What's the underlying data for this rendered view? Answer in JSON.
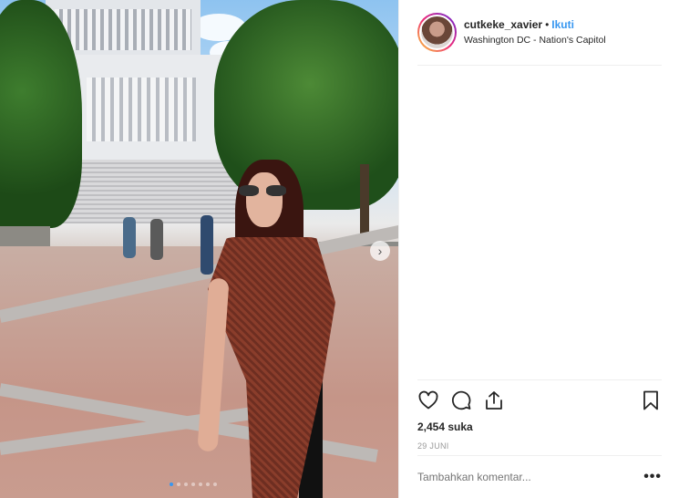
{
  "post": {
    "username": "cutkeke_xavier",
    "separator": "•",
    "follow_label": "Ikuti",
    "location": "Washington DC - Nation's Capitol",
    "likes": "2,454 suka",
    "date": "29 JUNI",
    "comment_placeholder": "Tambahkan komentar...",
    "more_label": "•••"
  },
  "carousel": {
    "next_icon": "chevron-right-icon",
    "next_glyph": "›",
    "total_dots": 7,
    "active_dot": 1
  },
  "icons": {
    "like": "heart-icon",
    "comment": "comment-icon",
    "share": "share-icon",
    "save": "bookmark-icon"
  },
  "colors": {
    "link": "#3897f0",
    "text": "#262626",
    "muted": "#999999",
    "divider": "#efefef"
  }
}
